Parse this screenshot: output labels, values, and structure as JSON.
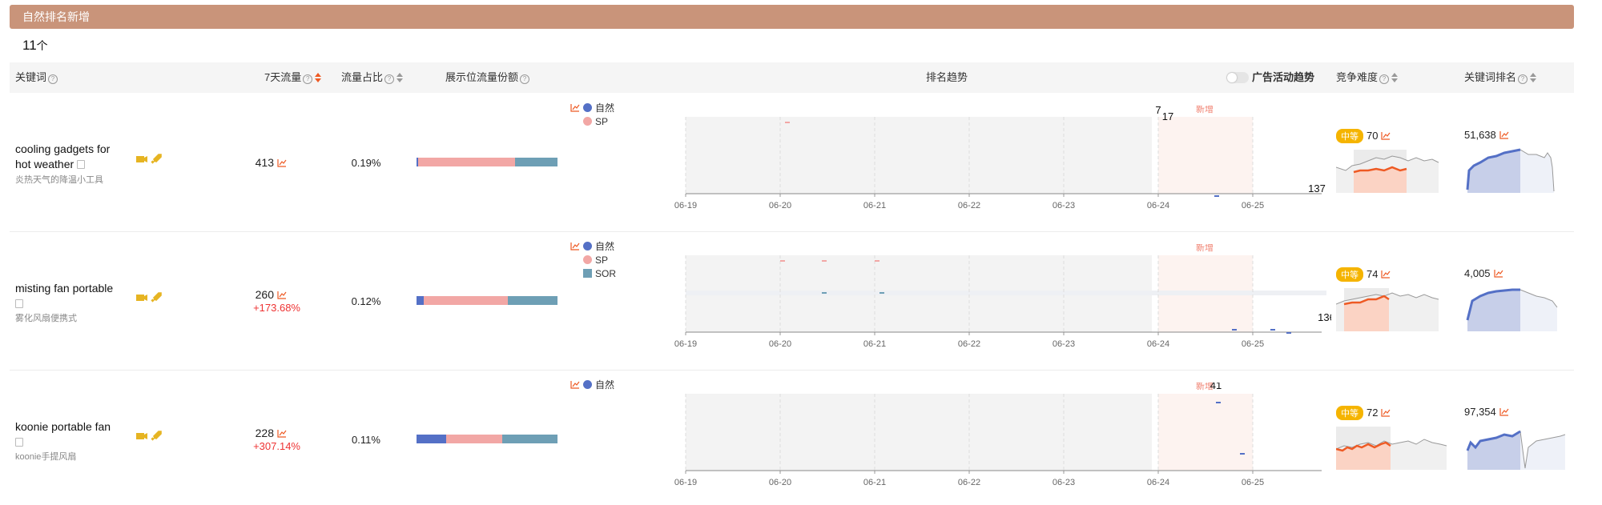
{
  "section_title": "自然排名新增",
  "count": {
    "value": "11",
    "unit": "个"
  },
  "columns": {
    "keyword": "关键词",
    "traffic7": "7天流量",
    "traffic_share": "流量占比",
    "placement_share": "展示位流量份额",
    "rank_trend": "排名趋势",
    "ad_toggle": "广告活动趋势",
    "competition": "竞争难度",
    "keyword_rank": "关键词排名"
  },
  "chart_dates": [
    "06-19",
    "06-20",
    "06-21",
    "06-22",
    "06-23",
    "06-24",
    "06-25"
  ],
  "new_label": "新增",
  "legend_labels": {
    "natural": "自然",
    "sp": "SP",
    "sor": "SOR"
  },
  "colors": {
    "natural": "#5470c6",
    "sp": "#f2a7a5",
    "sor": "#6e9fb5",
    "accent": "#ee5a24",
    "badge": "#f5b400"
  },
  "rows": [
    {
      "keyword": "cooling gadgets for hot weather",
      "keyword_cn": "炎热天气的降温小工具",
      "traffic7": "413",
      "growth": "",
      "share": "0.19%",
      "bar": {
        "natural": 1,
        "sp": 69,
        "sor": 30
      },
      "legend": [
        "natural",
        "sp"
      ],
      "labels": [
        {
          "text": "7",
          "series": "sp",
          "date": "06-24"
        },
        {
          "text": "17",
          "series": "sp",
          "date": "06-24"
        },
        {
          "text": "137",
          "series": "natural",
          "date": "06-25"
        }
      ],
      "competition": {
        "level": "中等",
        "score": "70"
      },
      "keyword_rank": "51,638"
    },
    {
      "keyword": "misting fan portable",
      "keyword_cn": "雾化风扇便携式",
      "traffic7": "260",
      "growth": "+173.68%",
      "share": "0.12%",
      "bar": {
        "natural": 5,
        "sp": 60,
        "sor": 35
      },
      "legend": [
        "natural",
        "sp",
        "sor"
      ],
      "labels": [
        {
          "text": "3",
          "series": "sp",
          "date": "06-20"
        },
        {
          "text": "9",
          "series": "sp",
          "date": "06-21"
        },
        {
          "text": "136",
          "series": "natural",
          "date": "06-25"
        },
        {
          "text": "143",
          "series": "natural",
          "date": "06-25"
        }
      ],
      "competition": {
        "level": "中等",
        "score": "74"
      },
      "keyword_rank": "4,005"
    },
    {
      "keyword": "koonie portable fan",
      "keyword_cn": "koonie手提风扇",
      "traffic7": "228",
      "growth": "+307.14%",
      "share": "0.11%",
      "bar": {
        "natural": 21,
        "sp": 40,
        "sor": 39
      },
      "legend": [
        "natural"
      ],
      "labels": [
        {
          "text": "41",
          "series": "natural",
          "date": "06-24"
        },
        {
          "text": "48",
          "series": "natural",
          "date": "06-25"
        }
      ],
      "competition": {
        "level": "中等",
        "score": "72"
      },
      "keyword_rank": "97,354"
    }
  ]
}
